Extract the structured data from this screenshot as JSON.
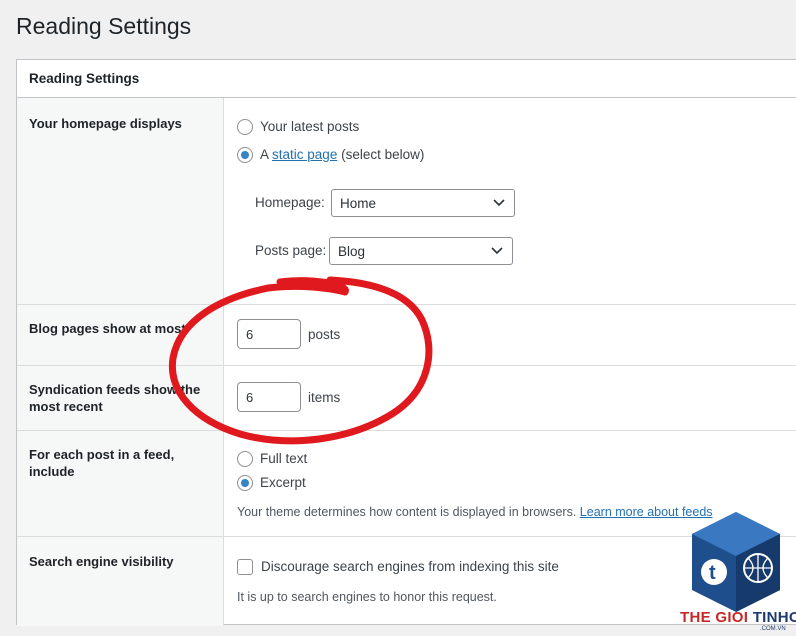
{
  "page": {
    "title": "Reading Settings"
  },
  "panel": {
    "header": "Reading Settings"
  },
  "homepage": {
    "label": "Your homepage displays",
    "option_latest": "Your latest posts",
    "option_static_prefix": "A",
    "option_static_link": "static page",
    "option_static_suffix": "(select below)",
    "selected": "static",
    "homepage_label": "Homepage:",
    "homepage_value": "Home",
    "posts_label": "Posts page:",
    "posts_value": "Blog"
  },
  "blog_pages": {
    "label": "Blog pages show at most",
    "value": "6",
    "unit": "posts"
  },
  "syndication": {
    "label": "Syndication feeds show the most recent",
    "value": "6",
    "unit": "items"
  },
  "feed": {
    "label": "For each post in a feed, include",
    "option_full": "Full text",
    "option_excerpt": "Excerpt",
    "selected": "excerpt",
    "description": "Your theme determines how content is displayed in browsers.",
    "learn_more": "Learn more about feeds"
  },
  "search": {
    "label": "Search engine visibility",
    "checkbox_label": "Discourage search engines from indexing this site",
    "checked": false,
    "description": "It is up to search engines to honor this request."
  },
  "watermark": {
    "name_red": "THE GIOI ",
    "name_dark": "TINHOC",
    "domain": ".COM.VN"
  },
  "colors": {
    "accent": "#2271b1",
    "radio_checked": "#3582c4",
    "annotation": "#e0191e"
  }
}
